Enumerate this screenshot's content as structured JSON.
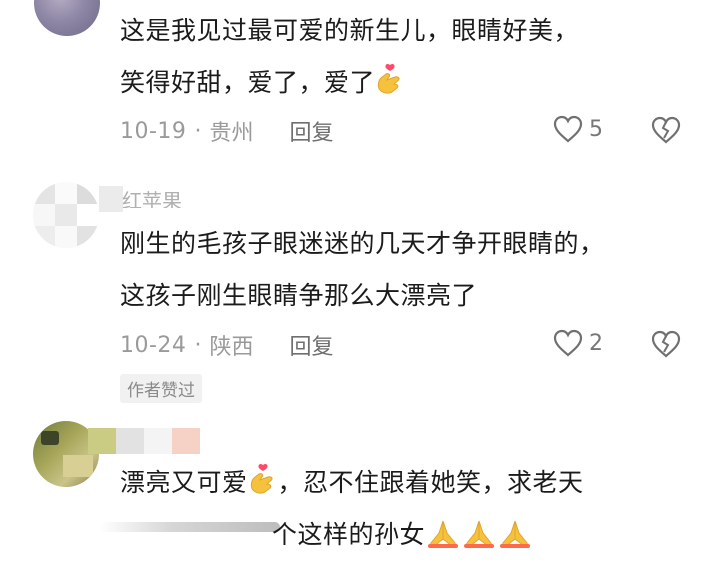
{
  "comments": [
    {
      "text_line1": "这是我见过最可爱的新生儿，眼睛好美，",
      "text_line2": "笑得好甜，爱了，爱了",
      "date": "10-19",
      "location": "贵州",
      "reply_label": "回复",
      "likes": "5"
    },
    {
      "username_partial": "红苹果",
      "text_line1": "刚生的毛孩子眼迷迷的几天才争开眼睛的，",
      "text_line2": "这孩子刚生眼睛争那么大漂亮了",
      "date": "10-24",
      "location": "陕西",
      "reply_label": "回复",
      "likes": "2",
      "badge": "作者赞过"
    },
    {
      "text_line1_a": "漂亮又可爱",
      "text_line1_b": "，忍不住跟着她笑，求老天",
      "text_line2": "个这样的孙女"
    }
  ],
  "icons": {
    "like": "heart-outline-icon",
    "dislike": "broken-heart-icon",
    "finger_heart": "finger-heart-emoji",
    "pray": "folded-hands-emoji"
  },
  "colors": {
    "text": "#1b1b1b",
    "meta": "#9a9a9a",
    "emoji_yellow": "#f6c23e",
    "heart_red": "#ff4a6b"
  }
}
